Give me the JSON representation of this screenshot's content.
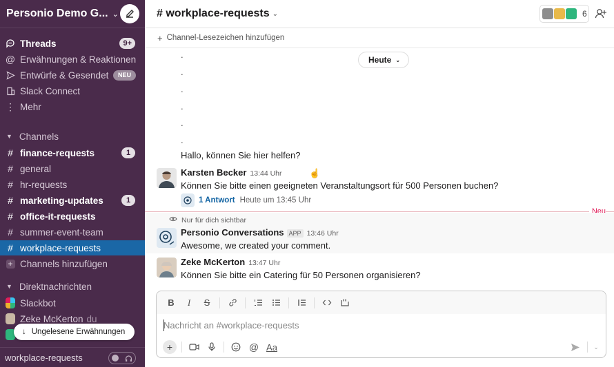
{
  "sidebar": {
    "workspace_name": "Personio Demo G...",
    "nav": [
      {
        "label": "Threads",
        "badge": "9+",
        "bold": true,
        "icon": "threads-icon"
      },
      {
        "label": "Erwähnungen & Reaktionen",
        "icon": "at-icon"
      },
      {
        "label": "Entwürfe & Gesendet",
        "tag": "NEU",
        "icon": "send-icon"
      },
      {
        "label": "Slack Connect",
        "icon": "building-icon"
      },
      {
        "label": "Mehr",
        "icon": "more-vertical-icon"
      }
    ],
    "channels_header": "Channels",
    "channels": [
      {
        "label": "finance-requests",
        "bold": true,
        "badge": "1"
      },
      {
        "label": "general"
      },
      {
        "label": "hr-requests"
      },
      {
        "label": "marketing-updates",
        "bold": true,
        "badge": "1"
      },
      {
        "label": "office-it-requests",
        "bold": true
      },
      {
        "label": "summer-event-team"
      },
      {
        "label": "workplace-requests",
        "active": true
      }
    ],
    "add_channels": "Channels hinzufügen",
    "dm_header": "Direktnachrichten",
    "dms": [
      {
        "label": "Slackbot"
      },
      {
        "label": "Zeke McKerton",
        "suffix": "du"
      }
    ],
    "unread_pill": "Ungelesene Erwähnungen",
    "footer_label": "workplace-requests"
  },
  "channel": {
    "hash": "#",
    "name": "workplace-requests",
    "member_count": "6",
    "bookmark_label": "Channel-Lesezeichen hinzufügen"
  },
  "messages": {
    "dots": [
      ".",
      ".",
      ".",
      ".",
      ".",
      "."
    ],
    "day_divider": "Heute",
    "first_text": "Hallo, können Sie hier helfen?",
    "karsten": {
      "name": "Karsten Becker",
      "time": "13:44 Uhr",
      "text": "Können Sie bitte einen geeigneten Veranstaltungsort für 500 Personen buchen?",
      "thread_replies": "1 Antwort",
      "thread_time": "Heute um 13:45 Uhr"
    },
    "new_divider": "Neu",
    "ephemeral_note": "Nur für dich sichtbar",
    "personio": {
      "name": "Personio Conversations",
      "app_tag": "APP",
      "time": "13:46 Uhr",
      "text": "Awesome, we created your comment."
    },
    "zeke": {
      "name": "Zeke McKerton",
      "time": "13:47 Uhr",
      "text": "Können Sie bitte ein Catering für 50 Personen organisieren?"
    }
  },
  "composer": {
    "placeholder": "Nachricht an #workplace-requests",
    "format_buttons": [
      "B",
      "I",
      "S"
    ],
    "aa_label": "Aa"
  },
  "colors": {
    "sidebar_bg": "#4a2b4b",
    "active_item": "#1a67a6",
    "link": "#1264a3",
    "new_divider": "#e01e5a"
  }
}
